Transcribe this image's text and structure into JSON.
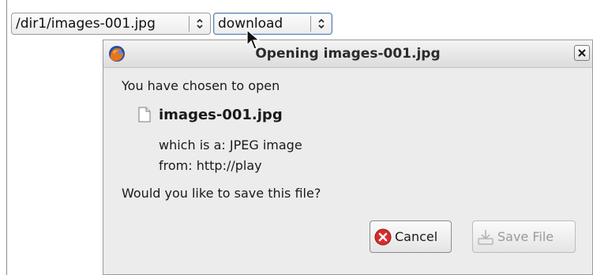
{
  "selects": {
    "path": "/dir1/images-001.jpg",
    "mode": "download"
  },
  "dialog": {
    "title": "Opening images-001.jpg",
    "intro": "You have chosen to open",
    "filename": "images-001.jpg",
    "type_label": "which is a:",
    "type_value": "JPEG image",
    "from_label": "from:",
    "from_value": "http://play",
    "question": "Would you like to save this file?",
    "cancel_label": "Cancel",
    "save_label": "Save File"
  },
  "icons": {
    "app": "firefox-icon",
    "close": "close-icon",
    "file": "file-icon",
    "cancel": "cancel-icon",
    "save": "save-icon"
  },
  "colors": {
    "cancel_red": "#d62c2c",
    "dialog_bg": "#ececec",
    "focus_border": "#5b7fae"
  }
}
